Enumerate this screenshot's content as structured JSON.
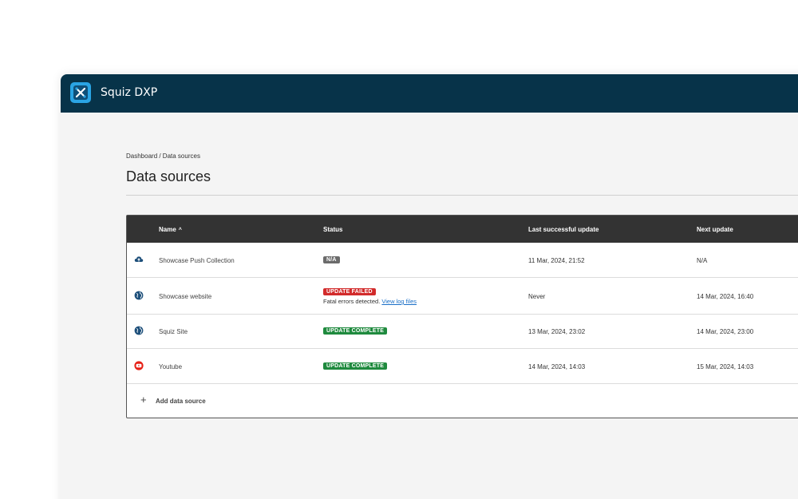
{
  "app": {
    "title": "Squiz DXP"
  },
  "breadcrumb": "Dashboard / Data sources",
  "page_title": "Data sources",
  "table": {
    "columns": {
      "name": "Name",
      "sort_indicator": "^",
      "status": "Status",
      "last": "Last successful update",
      "next": "Next update"
    },
    "rows": [
      {
        "icon": "cloud-upload-icon",
        "name": "Showcase Push Collection",
        "status": "N/A",
        "status_type": "na",
        "last": "11 Mar, 2024, 21:52",
        "next": "N/A"
      },
      {
        "icon": "globe-icon",
        "name": "Showcase website",
        "status": "UPDATE FAILED",
        "status_type": "failed",
        "note": "Fatal errors detected.",
        "link": "View log files",
        "last": "Never",
        "next": "14 Mar, 2024, 16:40"
      },
      {
        "icon": "globe-icon",
        "name": "Squiz Site",
        "status": "UPDATE COMPLETE",
        "status_type": "complete",
        "last": "13 Mar, 2024, 23:02",
        "next": "14 Mar, 2024, 23:00"
      },
      {
        "icon": "youtube-icon",
        "name": "Youtube",
        "status": "UPDATE COMPLETE",
        "status_type": "complete",
        "last": "14 Mar, 2024, 14:03",
        "next": "15 Mar, 2024, 14:03"
      }
    ],
    "add_label": "Add data source",
    "add_symbol": "+"
  },
  "colors": {
    "topbar": "#073349",
    "logo": "#2aa4e4",
    "failed": "#d22b2b",
    "complete": "#1f8a3e",
    "na": "#6b6b6b",
    "link": "#1a6fc7",
    "youtube": "#e62117",
    "globe": "#1d4f7a"
  }
}
